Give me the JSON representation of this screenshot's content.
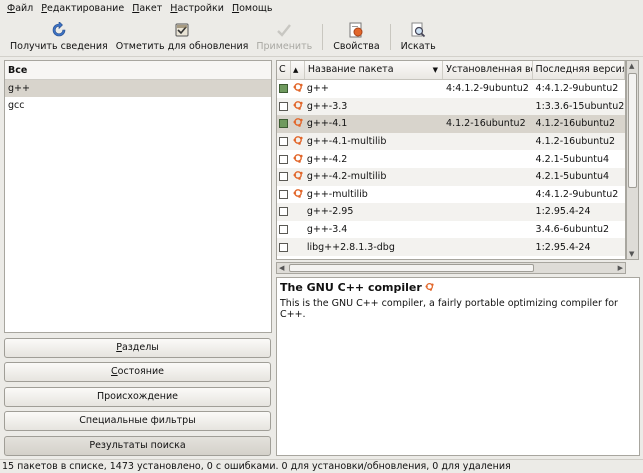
{
  "menu": [
    {
      "ul": "Ф",
      "rest": "айл"
    },
    {
      "ul": "Р",
      "rest": "едактирование"
    },
    {
      "ul": "П",
      "rest": "акет"
    },
    {
      "ul": "Н",
      "rest": "астройки"
    },
    {
      "ul": "П",
      "rest": "омощь"
    }
  ],
  "toolbar": {
    "reload": "Получить сведения",
    "mark_upgrades": "Отметить для обновления",
    "apply": "Применить",
    "properties": "Свойства",
    "search": "Искать"
  },
  "left": {
    "header": "Все",
    "items": [
      "g++",
      "gcc"
    ]
  },
  "filter_buttons": [
    {
      "ul": "Р",
      "rest": "азделы"
    },
    {
      "ul": "С",
      "rest": "остояние"
    },
    {
      "ul": "",
      "rest": "Происхождение"
    },
    {
      "ul": "",
      "rest": "Специальные фильтры"
    },
    {
      "ul": "",
      "rest": "Результаты поиска"
    }
  ],
  "table": {
    "columns": {
      "s": "С",
      "sup": "▲",
      "name": "Название пакета",
      "installed": "Установленная ве",
      "latest": "Последняя версия"
    },
    "rows": [
      {
        "checked": true,
        "supported": true,
        "name": "g++",
        "installed": "4:4.1.2-9ubuntu2",
        "latest": "4:4.1.2-9ubuntu2"
      },
      {
        "checked": false,
        "supported": true,
        "name": "g++-3.3",
        "installed": "",
        "latest": "1:3.3.6-15ubuntu2"
      },
      {
        "checked": true,
        "supported": true,
        "name": "g++-4.1",
        "installed": "4.1.2-16ubuntu2",
        "latest": "4.1.2-16ubuntu2"
      },
      {
        "checked": false,
        "supported": true,
        "name": "g++-4.1-multilib",
        "installed": "",
        "latest": "4.1.2-16ubuntu2"
      },
      {
        "checked": false,
        "supported": true,
        "name": "g++-4.2",
        "installed": "",
        "latest": "4.2.1-5ubuntu4"
      },
      {
        "checked": false,
        "supported": true,
        "name": "g++-4.2-multilib",
        "installed": "",
        "latest": "4.2.1-5ubuntu4"
      },
      {
        "checked": false,
        "supported": true,
        "name": "g++-multilib",
        "installed": "",
        "latest": "4:4.1.2-9ubuntu2"
      },
      {
        "checked": false,
        "supported": false,
        "name": "g++-2.95",
        "installed": "",
        "latest": "1:2.95.4-24"
      },
      {
        "checked": false,
        "supported": false,
        "name": "g++-3.4",
        "installed": "",
        "latest": "3.4.6-6ubuntu2"
      },
      {
        "checked": false,
        "supported": false,
        "name": "libg++2.8.1.3-dbg",
        "installed": "",
        "latest": "1:2.95.4-24"
      }
    ]
  },
  "description": {
    "title": "The GNU C++ compiler",
    "text": "This is the GNU C++ compiler, a fairly portable optimizing compiler for C++."
  },
  "status": "15 пакетов в списке, 1473 установлено, 0 с ошибками. 0 для установки/обновления, 0 для удаления",
  "colors": {
    "ubuntu_orange": "#e2672b",
    "selection": "#d8d4cc"
  }
}
